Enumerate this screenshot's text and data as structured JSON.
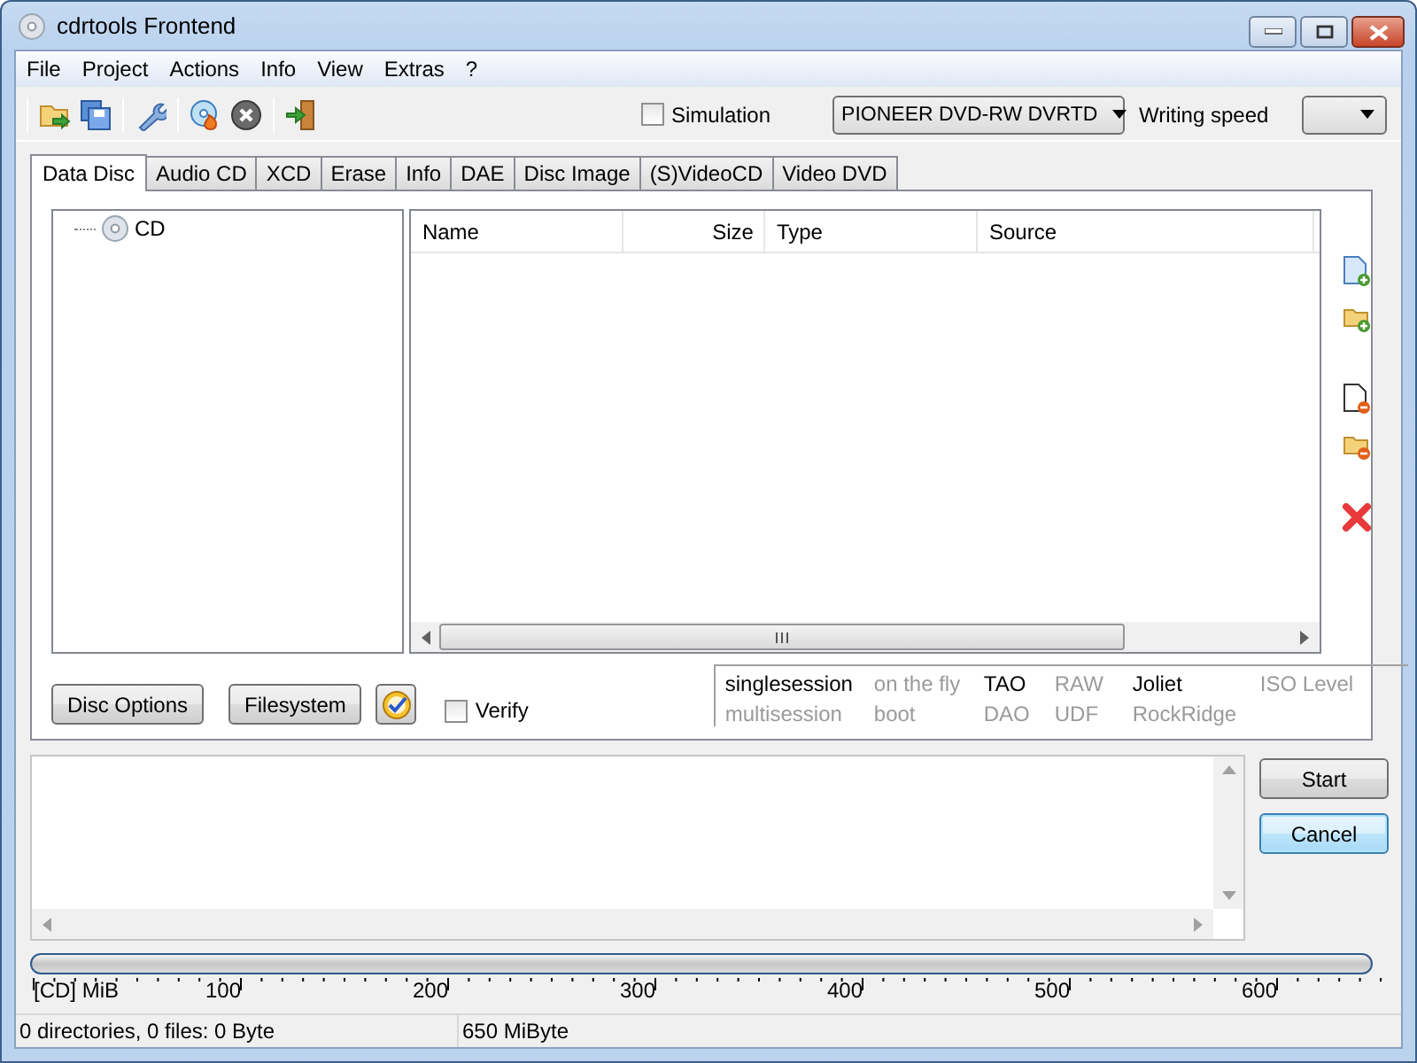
{
  "window": {
    "title": "cdrtools Frontend"
  },
  "menu": [
    "File",
    "Project",
    "Actions",
    "Info",
    "View",
    "Extras",
    "?"
  ],
  "toolbar": {
    "simulation": {
      "label": "Simulation",
      "checked": false
    },
    "drive": "PIONEER DVD-RW DVRTD",
    "speed_label": "Writing speed"
  },
  "tabs": [
    {
      "label": "Data Disc",
      "selected": true
    },
    {
      "label": "Audio CD",
      "selected": false
    },
    {
      "label": "XCD",
      "selected": false
    },
    {
      "label": "Erase",
      "selected": false
    },
    {
      "label": "Info",
      "selected": false
    },
    {
      "label": "DAE",
      "selected": false
    },
    {
      "label": "Disc Image",
      "selected": false
    },
    {
      "label": "(S)VideoCD",
      "selected": false
    },
    {
      "label": "Video DVD",
      "selected": false
    }
  ],
  "tree": [
    {
      "label": "CD"
    }
  ],
  "file_list": {
    "columns": [
      "Name",
      "Size",
      "Type",
      "Source"
    ]
  },
  "buttons": [
    "Disc Options",
    "Filesystem"
  ],
  "verify": {
    "label": "Verify",
    "checked": false
  },
  "options": [
    [
      {
        "label": "singlesession",
        "active": true
      },
      {
        "label": "on the fly",
        "active": false
      },
      {
        "label": "TAO",
        "active": true
      },
      {
        "label": "RAW",
        "active": false
      },
      {
        "label": "Joliet",
        "active": true
      },
      {
        "label": "ISO Level",
        "active": false
      }
    ],
    [
      {
        "label": "multisession",
        "active": false
      },
      {
        "label": "boot",
        "active": false
      },
      {
        "label": "DAO",
        "active": false
      },
      {
        "label": "UDF",
        "active": false
      },
      {
        "label": "RockRidge",
        "active": false
      }
    ]
  ],
  "actions": [
    {
      "label": "Start",
      "focused": false
    },
    {
      "label": "Cancel",
      "focused": true
    }
  ],
  "progress": {
    "level": 0
  },
  "ruler": {
    "unit": "[CD] MiB",
    "ticks": [
      "100",
      "200",
      "300",
      "400",
      "500",
      "600"
    ]
  },
  "status_bar": [
    "0 directories, 0 files: 0 Byte",
    "650 MiByte"
  ]
}
